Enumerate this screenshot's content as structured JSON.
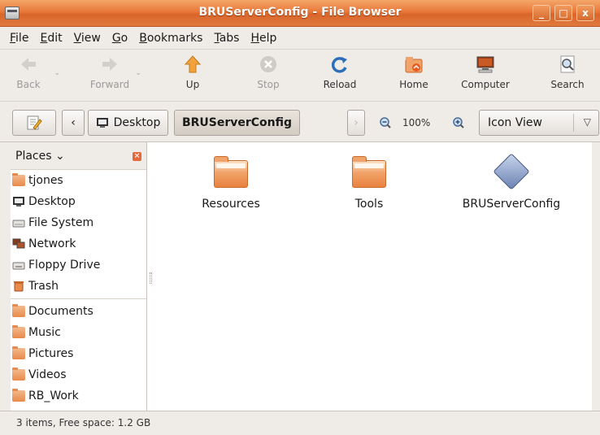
{
  "window": {
    "title": "BRUServerConfig - File Browser",
    "buttons": {
      "minimize": "_",
      "maximize": "□",
      "close": "x"
    }
  },
  "menu": [
    {
      "label": "File",
      "key": "F",
      "rest": "ile"
    },
    {
      "label": "Edit",
      "key": "E",
      "rest": "dit"
    },
    {
      "label": "View",
      "key": "V",
      "rest": "iew"
    },
    {
      "label": "Go",
      "key": "G",
      "rest": "o"
    },
    {
      "label": "Bookmarks",
      "key": "B",
      "rest": "ookmarks"
    },
    {
      "label": "Tabs",
      "key": "T",
      "rest": "abs"
    },
    {
      "label": "Help",
      "key": "H",
      "rest": "elp"
    }
  ],
  "toolbar": {
    "back": "Back",
    "forward": "Forward",
    "up": "Up",
    "stop": "Stop",
    "reload": "Reload",
    "home": "Home",
    "computer": "Computer",
    "search": "Search"
  },
  "location": {
    "crumb_desktop": "Desktop",
    "crumb_current": "BRUServerConfig",
    "zoom": "100%",
    "view_mode": "Icon View"
  },
  "sidebar": {
    "header": "Places",
    "places": [
      {
        "label": "tjones",
        "icon": "home-folder-icon"
      },
      {
        "label": "Desktop",
        "icon": "desktop-icon"
      },
      {
        "label": "File System",
        "icon": "drive-icon"
      },
      {
        "label": "Network",
        "icon": "network-icon"
      },
      {
        "label": "Floppy Drive",
        "icon": "floppy-icon"
      },
      {
        "label": "Trash",
        "icon": "trash-icon"
      }
    ],
    "bookmarks": [
      {
        "label": "Documents",
        "icon": "folder-icon"
      },
      {
        "label": "Music",
        "icon": "folder-icon"
      },
      {
        "label": "Pictures",
        "icon": "folder-icon"
      },
      {
        "label": "Videos",
        "icon": "folder-icon"
      },
      {
        "label": "RB_Work",
        "icon": "folder-icon"
      }
    ]
  },
  "files": [
    {
      "name": "Resources",
      "icon": "folder-icon"
    },
    {
      "name": "Tools",
      "icon": "folder-icon"
    },
    {
      "name": "BRUServerConfig",
      "icon": "executable-icon"
    }
  ],
  "status": "3 items, Free space: 1.2 GB",
  "colors": {
    "title_orange": "#e8783a",
    "chrome_bg": "#efebe7",
    "folder_orange": "#f2a36a"
  }
}
